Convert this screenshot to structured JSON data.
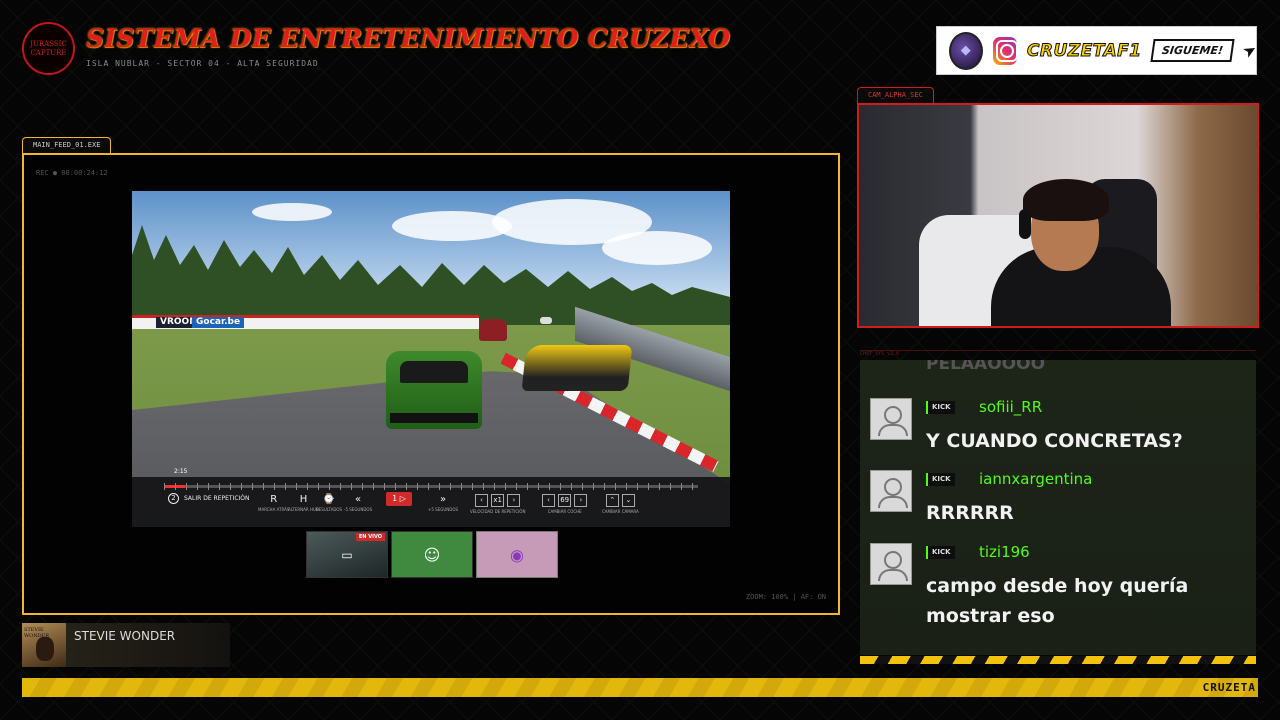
{
  "header": {
    "logo_text": "JURASSIC CAPTURE",
    "title": "SISTEMA DE ENTRETENIMIENTO CRUZEXO",
    "subtitle": "ISLA NUBLAR - SECTOR 04 - ALTA SEGURIDAD"
  },
  "social": {
    "handle": "CRUZETAF1",
    "follow_label": "SIGUEME!"
  },
  "main_feed": {
    "tab_label": "MAIN_FEED_01.EXE",
    "rec_label": "REC ● 00:00:24:12",
    "zoom_label": "ZOOM: 100% | AF: ON"
  },
  "game": {
    "lap_time": "2:15",
    "ads": [
      "VROOM",
      "Gocar.be"
    ],
    "exit_replay_label": "SALIR DE REPETICIÓN",
    "exit_key": "2",
    "replay_progress": 0.04,
    "controls": [
      {
        "key": "R",
        "label": "MARCHA ATRÁS"
      },
      {
        "key": "H",
        "label": "ALTERNAR HUD"
      },
      {
        "key": "⌚",
        "label": "RESULTADOS"
      },
      {
        "key": "«",
        "label": "-5 SEGUNDOS"
      },
      {
        "key": "»",
        "label": "+5 SEGUNDOS"
      },
      {
        "key": "x1",
        "label": "VELOCIDAD DE REPETICIÓN"
      },
      {
        "key": "69",
        "label": "CAMBIAR COCHE"
      },
      {
        "key": "⌄",
        "label": "CAMBIAR CÁMARA"
      }
    ],
    "play_label": "JUGAR",
    "play_key": "1"
  },
  "thumbnails": {
    "live_badge": "EN VIVO"
  },
  "webcam": {
    "tab_label": "CAM_ALPHA_SEC"
  },
  "chat": {
    "header_label": "CHAT_SYS_v2.0",
    "cut_text": "PELAAOOOO",
    "messages": [
      {
        "platform": "KICK",
        "user": "sofiii_RR",
        "text": "Y CUANDO CONCRETAS?"
      },
      {
        "platform": "KICK",
        "user": "iannxargentina",
        "text": "RRRRRR"
      },
      {
        "platform": "KICK",
        "user": "tizi196",
        "text": "campo desde hoy quería mostrar eso"
      }
    ]
  },
  "music": {
    "album_text": "STEVIE WONDER",
    "title": "STEVIE WONDER"
  },
  "footer": {
    "ticker": "CRUZETA"
  },
  "colors": {
    "accent_red": "#d11c1c",
    "accent_yellow": "#f2b632",
    "kick_green": "#53fc18"
  }
}
